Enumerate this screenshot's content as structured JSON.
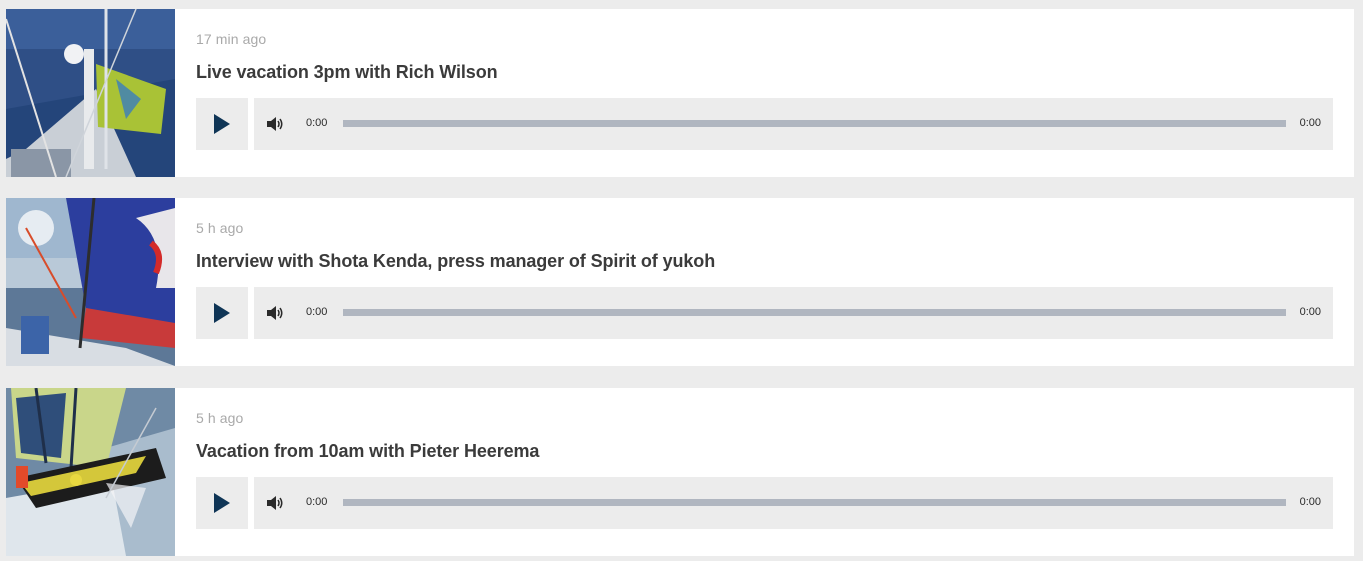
{
  "colors": {
    "page_background": "#ececec",
    "card_background": "#ffffff",
    "timestamp": "#a9a9a9",
    "title": "#3b3b3b",
    "play_icon": "#0f3556",
    "progress_track": "#b0b6c0"
  },
  "episodes": [
    {
      "thumbnail_icon": "sailboat-deck-flag-photo",
      "timestamp": "17 min ago",
      "title": "Live vacation 3pm with Rich Wilson",
      "player": {
        "current_time": "0:00",
        "duration": "0:00",
        "progress": 0
      }
    },
    {
      "thumbnail_icon": "sailboat-blue-sail-photo",
      "timestamp": "5 h ago",
      "title": "Interview with Shota Kenda, press manager of Spirit of yukoh",
      "player": {
        "current_time": "0:00",
        "duration": "0:00",
        "progress": 0
      }
    },
    {
      "thumbnail_icon": "sailboat-racing-yellow-hull-photo",
      "timestamp": "5 h ago",
      "title": "Vacation from 10am with Pieter Heerema",
      "player": {
        "current_time": "0:00",
        "duration": "0:00",
        "progress": 0
      }
    }
  ]
}
